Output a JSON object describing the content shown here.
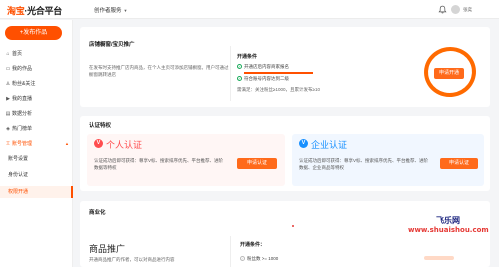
{
  "header": {
    "logo_main": "淘宝",
    "logo_rest": "·光合平台",
    "service_menu": "创作者服务",
    "user_name": "张奕",
    "icons": [
      "bell-icon",
      "avatar"
    ]
  },
  "sidebar": {
    "publish_label": "+发布作品",
    "items": [
      {
        "icon": "home-icon",
        "glyph": "⌂",
        "label": "首页"
      },
      {
        "icon": "works-icon",
        "glyph": "▭",
        "label": "我的作品"
      },
      {
        "icon": "fans-icon",
        "glyph": "♙",
        "label": "粉丝&关注"
      },
      {
        "icon": "live-icon",
        "glyph": "▶",
        "label": "我的直播"
      },
      {
        "icon": "data-icon",
        "glyph": "▤",
        "label": "数据分析"
      },
      {
        "icon": "hot-icon",
        "glyph": "◈",
        "label": "热门榜单"
      },
      {
        "icon": "account-icon",
        "glyph": "♖",
        "label": "账号管理"
      }
    ],
    "sub_items": [
      {
        "label": "账号设置"
      },
      {
        "label": "身份认证"
      },
      {
        "label": "权限开通"
      }
    ]
  },
  "store_card": {
    "title": "店铺橱窗/宝贝推广",
    "description": "在发布时支持推广店内商品，在个人主页可添加店铺橱窗。用户可通过橱窗跳转进店",
    "conditions_title": "开通条件",
    "condition_1_prefix": "开通店后内容商家报名",
    "condition_1_link": "",
    "condition_2": "符合账号内容达到二级",
    "note": "需满足：关注粉丝≥1000，且累计发布≥10",
    "apply_label": "申请开通"
  },
  "cert_card": {
    "title": "认证特权",
    "personal": {
      "badge": "V",
      "name": "个人认证",
      "description": "认证成功后即可获得：尊享V标、搜索排序优先、平台推荐、进阶数据等特权",
      "button": "申请认证",
      "color": "#ff4d4f"
    },
    "enterprise": {
      "badge": "V",
      "name": "企业认证",
      "description": "认证成功后即可获得：尊享V标、搜索排序优先、平台推荐、进阶数据、企业商品等特权",
      "button": "申请认证",
      "color": "#1890ff"
    }
  },
  "commerce_card": {
    "title": "商业化",
    "big_title": "商品推广",
    "description": "开通商品推广的作者，可以对商品进行内容",
    "conditions_title": "开通条件：",
    "condition_1": "粉丝数 >= 1000"
  },
  "watermark": {
    "name": "飞乐网",
    "url": "www.shuaishou.com"
  },
  "colors": {
    "accent": "#ff5000",
    "button": "#ff6a1a",
    "annotation": "#ff6a00",
    "check": "#1aab5b"
  }
}
